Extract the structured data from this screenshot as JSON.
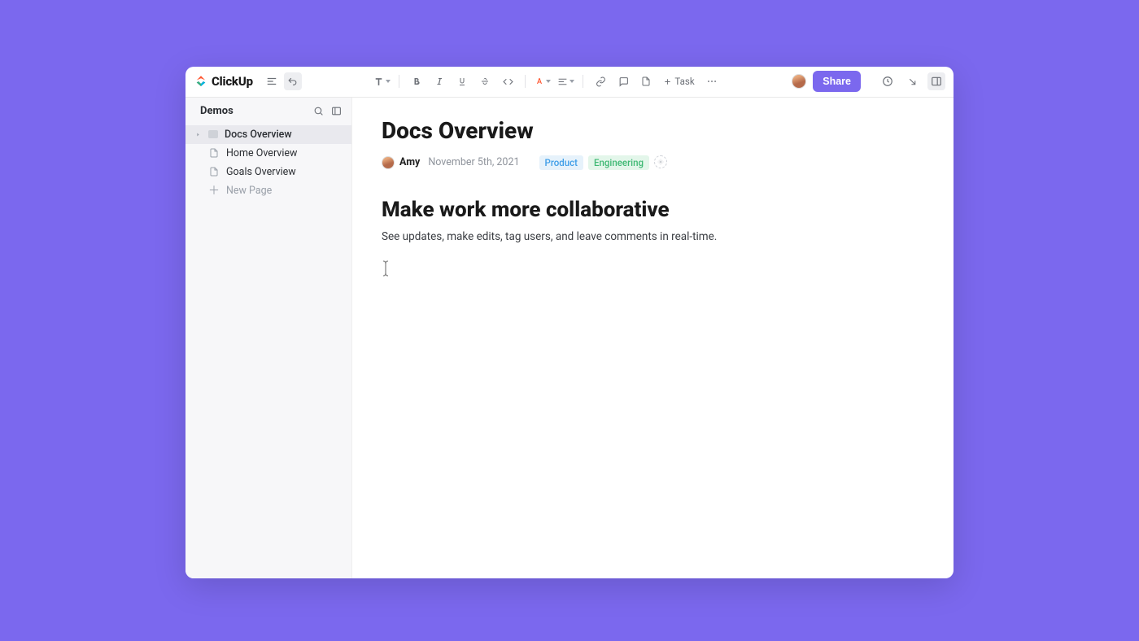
{
  "brand": {
    "name": "ClickUp"
  },
  "toolbar": {
    "task_label": "Task"
  },
  "actions": {
    "share_label": "Share"
  },
  "sidebar": {
    "title": "Demos",
    "items": [
      {
        "label": "Docs Overview",
        "active": true
      },
      {
        "label": "Home Overview",
        "active": false
      },
      {
        "label": "Goals Overview",
        "active": false
      }
    ],
    "new_page_label": "New Page"
  },
  "document": {
    "title": "Docs Overview",
    "author": "Amy",
    "date": "November 5th, 2021",
    "tags": [
      {
        "label": "Product",
        "kind": "product"
      },
      {
        "label": "Engineering",
        "kind": "engineering"
      }
    ],
    "section_heading": "Make work more collaborative",
    "section_text": "See updates, make edits, tag users, and leave comments in real-time."
  }
}
